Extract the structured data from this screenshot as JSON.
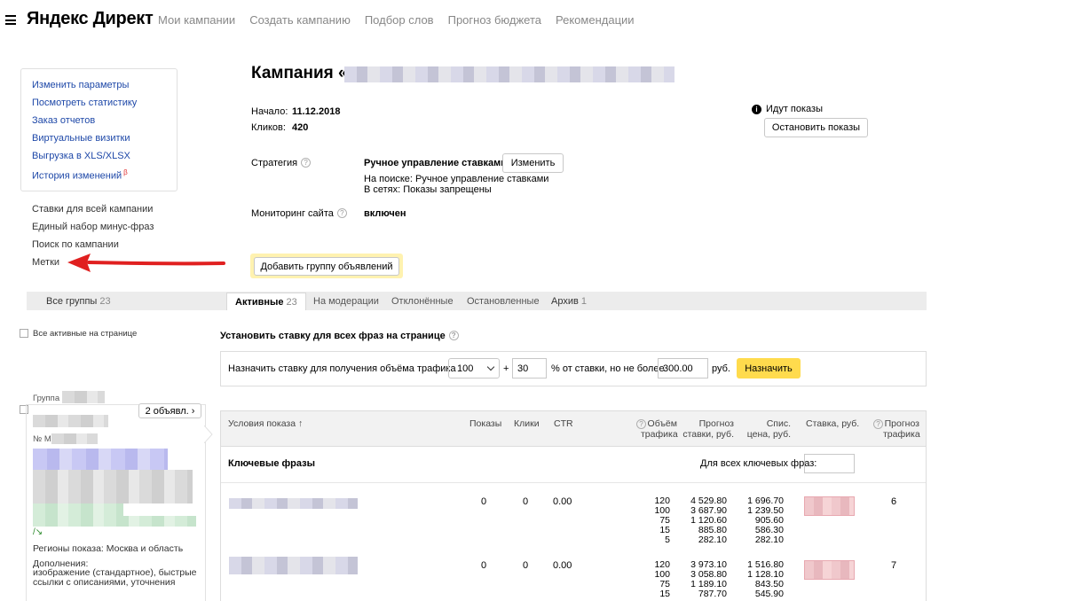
{
  "header": {
    "logo": "Яндекс Директ",
    "nav": [
      "Мои кампании",
      "Создать кампанию",
      "Подбор слов",
      "Прогноз бюджета",
      "Рекомендации"
    ]
  },
  "sidebar": {
    "box_links": [
      "Изменить параметры",
      "Посмотреть статистику",
      "Заказ отчетов",
      "Виртуальные визитки",
      "Выгрузка в XLS/XLSX",
      "История изменений"
    ],
    "beta": "β",
    "links": [
      "Ставки для всей кампании",
      "Единый набор минус-фраз",
      "Поиск по кампании",
      "Метки"
    ]
  },
  "campaign": {
    "title": "Кампания «",
    "start_label": "Начало:",
    "start_value": "11.12.2018",
    "clicks_label": "Кликов:",
    "clicks_value": "420",
    "strategy_label": "Стратегия",
    "strategy_value": "Ручное управление ставками",
    "strategy_change": "Изменить",
    "strategy_search": "На поиске: Ручное управление ставками",
    "strategy_networks": "В сетях: Показы запрещены",
    "monitoring_label": "Мониторинг сайта",
    "monitoring_value": "включен",
    "status_icon": "info-icon",
    "status": "Идут показы",
    "stop_button": "Остановить показы",
    "add_group_button": "Добавить группу объявлений"
  },
  "tabs": {
    "all_groups": "Все группы",
    "all_groups_count": "23",
    "items": [
      {
        "label": "Активные",
        "count": "23"
      },
      {
        "label": "На модерации",
        "count": ""
      },
      {
        "label": "Отклонённые",
        "count": ""
      },
      {
        "label": "Остановленные",
        "count": ""
      },
      {
        "label": "Архив",
        "count": "1"
      }
    ]
  },
  "left_panel": {
    "all_active": "Все активные на странице",
    "group_label": "Группа",
    "ads_button": "2 объявл. ›",
    "ad_prefix": "№ М",
    "regions": "Регионы показа: Москва и область",
    "additions_label": "Дополнения:",
    "additions_text": "изображение (стандартное), быстрые ссылки с описаниями, уточнения"
  },
  "bid": {
    "title": "Установить ставку для всех фраз на странице",
    "label": "Назначить ставку для получения объёма трафика",
    "traffic_value": "100",
    "plus": "+",
    "percent_value": "30",
    "percent_label": "% от ставки, но не более",
    "max_value": "300.00",
    "currency": "руб.",
    "assign_button": "Назначить"
  },
  "table": {
    "headers": {
      "conditions": "Условия показа ↑",
      "shows": "Показы",
      "clicks": "Клики",
      "ctr": "CTR",
      "traffic": "Объём\nтрафика",
      "forecast": "Прогноз\nставки, руб.",
      "writeoff": "Спис.\nцена, руб.",
      "bid": "Ставка, руб.",
      "traffic_forecast": "Прогноз\nтрафика"
    },
    "keywords_label": "Ключевые фразы",
    "all_keywords_label": "Для всех ключевых фраз:",
    "rows": [
      {
        "shows": "0",
        "clicks": "0",
        "ctr": "0.00",
        "traffic": "120\n100\n75\n15\n5",
        "forecast": "4 529.80\n3 687.90\n1 120.60\n885.80\n282.10",
        "writeoff": "1 696.70\n1 239.50\n905.60\n586.30\n282.10",
        "traffic_forecast": "6"
      },
      {
        "shows": "0",
        "clicks": "0",
        "ctr": "0.00",
        "traffic": "120\n100\n75\n15",
        "forecast": "3 973.10\n3 058.80\n1 189.10\n787.70",
        "writeoff": "1 516.80\n1 128.10\n843.50\n545.90",
        "traffic_forecast": "7"
      }
    ]
  },
  "colors": {
    "accent_yellow": "#ffdb4d",
    "link_blue": "#1e48a8",
    "arrow_red": "#e02020"
  }
}
